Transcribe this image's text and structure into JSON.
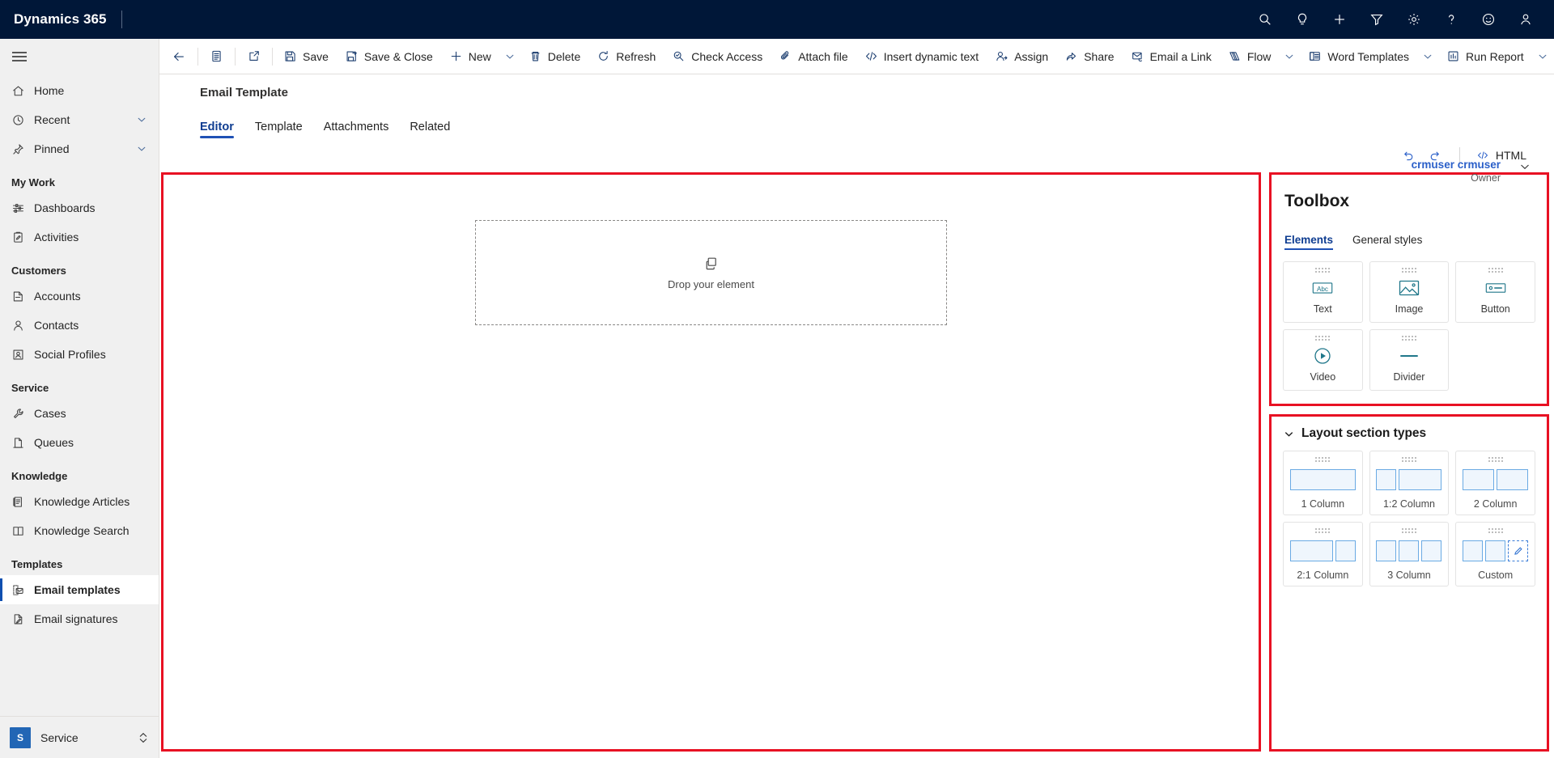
{
  "topbar": {
    "brand": "Dynamics 365",
    "icons": [
      {
        "name": "search-icon",
        "label": "Search"
      },
      {
        "name": "lightbulb-icon",
        "label": "Insights"
      },
      {
        "name": "plus-icon",
        "label": "New"
      },
      {
        "name": "filter-icon",
        "label": "Filter"
      },
      {
        "name": "gear-icon",
        "label": "Settings"
      },
      {
        "name": "question-icon",
        "label": "Help"
      },
      {
        "name": "smiley-icon",
        "label": "Feedback"
      },
      {
        "name": "person-icon",
        "label": "Account manager"
      }
    ]
  },
  "sidebar": {
    "items": [
      {
        "label": "Home",
        "icon": "home-icon",
        "type": "item",
        "selected": false,
        "chevron": false
      },
      {
        "label": "Recent",
        "icon": "clock-icon",
        "type": "item",
        "selected": false,
        "chevron": true
      },
      {
        "label": "Pinned",
        "icon": "pin-icon",
        "type": "item",
        "selected": false,
        "chevron": true
      },
      {
        "label": "My Work",
        "type": "group"
      },
      {
        "label": "Dashboards",
        "icon": "dashboard-icon",
        "type": "item",
        "selected": false,
        "chevron": false
      },
      {
        "label": "Activities",
        "icon": "activities-icon",
        "type": "item",
        "selected": false,
        "chevron": false
      },
      {
        "label": "Customers",
        "type": "group"
      },
      {
        "label": "Accounts",
        "icon": "accounts-icon",
        "type": "item",
        "selected": false,
        "chevron": false
      },
      {
        "label": "Contacts",
        "icon": "contact-icon",
        "type": "item",
        "selected": false,
        "chevron": false
      },
      {
        "label": "Social Profiles",
        "icon": "social-profile-icon",
        "type": "item",
        "selected": false,
        "chevron": false
      },
      {
        "label": "Service",
        "type": "group"
      },
      {
        "label": "Cases",
        "icon": "wrench-icon",
        "type": "item",
        "selected": false,
        "chevron": false
      },
      {
        "label": "Queues",
        "icon": "queue-icon",
        "type": "item",
        "selected": false,
        "chevron": false
      },
      {
        "label": "Knowledge",
        "type": "group"
      },
      {
        "label": "Knowledge Articles",
        "icon": "article-icon",
        "type": "item",
        "selected": false,
        "chevron": false
      },
      {
        "label": "Knowledge Search",
        "icon": "book-icon",
        "type": "item",
        "selected": false,
        "chevron": false
      },
      {
        "label": "Templates",
        "type": "group"
      },
      {
        "label": "Email templates",
        "icon": "email-template-icon",
        "type": "item",
        "selected": true,
        "chevron": false
      },
      {
        "label": "Email signatures",
        "icon": "signature-icon",
        "type": "item",
        "selected": false,
        "chevron": false
      }
    ],
    "footer": {
      "badge": "S",
      "app_name": "Service"
    }
  },
  "commandbar": {
    "items": [
      {
        "label": "",
        "icon": "back-arrow-icon",
        "icon_only": true
      },
      {
        "type": "separator"
      },
      {
        "label": "",
        "icon": "form-icon",
        "icon_only": true
      },
      {
        "type": "separator"
      },
      {
        "label": "",
        "icon": "popout-icon",
        "icon_only": true
      },
      {
        "type": "separator"
      },
      {
        "label": "Save",
        "icon": "save-icon"
      },
      {
        "label": "Save & Close",
        "icon": "save-close-icon"
      },
      {
        "label": "New",
        "icon": "plus-icon"
      },
      {
        "type": "caret"
      },
      {
        "label": "Delete",
        "icon": "trash-icon"
      },
      {
        "label": "Refresh",
        "icon": "refresh-icon"
      },
      {
        "label": "Check Access",
        "icon": "check-access-icon"
      },
      {
        "label": "Attach file",
        "icon": "paperclip-icon"
      },
      {
        "label": "Insert dynamic text",
        "icon": "code-icon"
      },
      {
        "label": "Assign",
        "icon": "assign-icon"
      },
      {
        "label": "Share",
        "icon": "share-icon"
      },
      {
        "label": "Email a Link",
        "icon": "email-link-icon"
      },
      {
        "label": "Flow",
        "icon": "flow-icon"
      },
      {
        "type": "caret"
      },
      {
        "label": "Word Templates",
        "icon": "word-template-icon"
      },
      {
        "type": "caret"
      },
      {
        "label": "Run Report",
        "icon": "run-report-icon"
      },
      {
        "type": "caret"
      }
    ]
  },
  "form": {
    "record_title": "Email Template",
    "owner": {
      "name": "crmuser crmuser",
      "role": "Owner"
    },
    "tabs": [
      {
        "label": "Editor",
        "active": true
      },
      {
        "label": "Template",
        "active": false
      },
      {
        "label": "Attachments",
        "active": false
      },
      {
        "label": "Related",
        "active": false
      }
    ]
  },
  "editor_tools": {
    "undo_label": "Undo",
    "redo_label": "Redo",
    "html_label": "HTML"
  },
  "canvas": {
    "dropzone_text": "Drop your element"
  },
  "toolbox": {
    "title": "Toolbox",
    "tabs": [
      {
        "label": "Elements",
        "active": true
      },
      {
        "label": "General styles",
        "active": false
      }
    ],
    "elements": [
      {
        "label": "Text",
        "icon": "text-abc-icon"
      },
      {
        "label": "Image",
        "icon": "image-icon"
      },
      {
        "label": "Button",
        "icon": "button-icon"
      },
      {
        "label": "Video",
        "icon": "video-play-icon"
      },
      {
        "label": "Divider",
        "icon": "divider-icon"
      }
    ]
  },
  "layout_section": {
    "title": "Layout section types",
    "expanded": true,
    "items": [
      {
        "label": "1 Column",
        "columns": [
          1
        ],
        "custom": false
      },
      {
        "label": "1:2 Column",
        "columns": [
          1,
          2
        ],
        "custom": false
      },
      {
        "label": "2 Column",
        "columns": [
          1,
          1
        ],
        "custom": false
      },
      {
        "label": "2:1 Column",
        "columns": [
          2,
          1
        ],
        "custom": false
      },
      {
        "label": "3 Column",
        "columns": [
          1,
          1,
          1
        ],
        "custom": false
      },
      {
        "label": "Custom",
        "columns": [
          1,
          1,
          1
        ],
        "custom": true
      }
    ]
  },
  "colors": {
    "topbar_bg": "#001738",
    "accent": "#1f51b5",
    "highlight_border": "#e81123",
    "tile_icon": "#20778a",
    "link": "#2a5fc9"
  }
}
